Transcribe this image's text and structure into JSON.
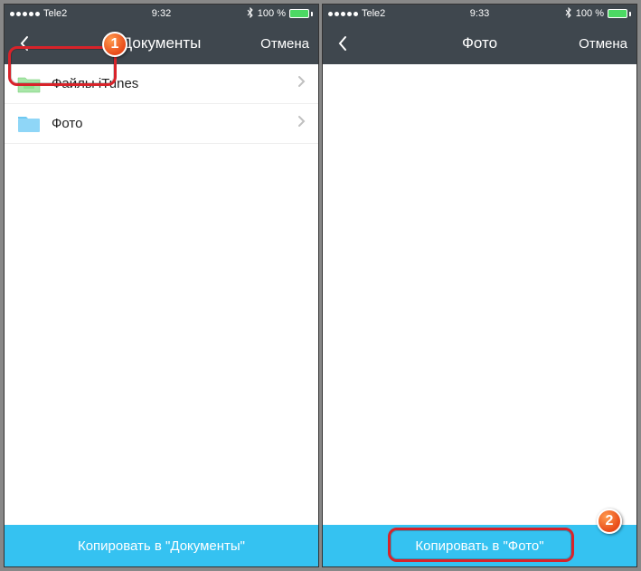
{
  "left": {
    "status": {
      "carrier": "Tele2",
      "time": "9:32",
      "battery": "100 %"
    },
    "nav": {
      "title": "Документы",
      "cancel": "Отмена"
    },
    "items": [
      {
        "label": "Файлы iTunes",
        "iconClass": "folder-green"
      },
      {
        "label": "Фото",
        "iconClass": "folder-blue"
      }
    ],
    "bottom": "Копировать в \"Документы\"",
    "callout": "1"
  },
  "right": {
    "status": {
      "carrier": "Tele2",
      "time": "9:33",
      "battery": "100 %"
    },
    "nav": {
      "title": "Фото",
      "cancel": "Отмена"
    },
    "bottom": "Копировать в \"Фото\"",
    "callout": "2"
  }
}
